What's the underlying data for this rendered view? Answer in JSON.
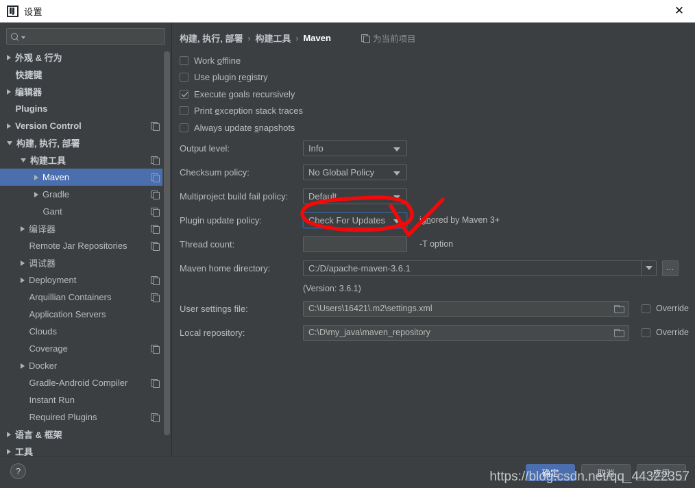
{
  "window": {
    "title": "设置",
    "logo_icon": "intellij-idea-logo",
    "close_icon": "close-icon"
  },
  "sidebar": {
    "search": {
      "placeholder": "",
      "value": "",
      "icon": "search-icon",
      "caret_icon": "chevron-down-icon"
    },
    "items": [
      {
        "label": "外观 & 行为",
        "indent": 0,
        "twisty": "collapsed",
        "bold": true,
        "module": false,
        "selected": false
      },
      {
        "label": "快捷键",
        "indent": 0,
        "twisty": "none",
        "bold": true,
        "module": false,
        "selected": false
      },
      {
        "label": "编辑器",
        "indent": 0,
        "twisty": "collapsed",
        "bold": true,
        "module": false,
        "selected": false
      },
      {
        "label": "Plugins",
        "indent": 0,
        "twisty": "none",
        "bold": true,
        "module": false,
        "selected": false
      },
      {
        "label": "Version Control",
        "indent": 0,
        "twisty": "collapsed",
        "bold": true,
        "module": true,
        "selected": false
      },
      {
        "label": "构建, 执行, 部署",
        "indent": 0,
        "twisty": "expanded",
        "bold": true,
        "module": false,
        "selected": false
      },
      {
        "label": "构建工具",
        "indent": 1,
        "twisty": "expanded",
        "bold": true,
        "module": true,
        "selected": false
      },
      {
        "label": "Maven",
        "indent": 2,
        "twisty": "collapsed",
        "bold": false,
        "module": true,
        "selected": true
      },
      {
        "label": "Gradle",
        "indent": 2,
        "twisty": "collapsed",
        "bold": false,
        "module": true,
        "selected": false
      },
      {
        "label": "Gant",
        "indent": 2,
        "twisty": "none",
        "bold": false,
        "module": true,
        "selected": false
      },
      {
        "label": "编译器",
        "indent": 1,
        "twisty": "collapsed",
        "bold": false,
        "module": true,
        "selected": false
      },
      {
        "label": "Remote Jar Repositories",
        "indent": 1,
        "twisty": "none",
        "bold": false,
        "module": true,
        "selected": false
      },
      {
        "label": "调试器",
        "indent": 1,
        "twisty": "collapsed",
        "bold": false,
        "module": false,
        "selected": false
      },
      {
        "label": "Deployment",
        "indent": 1,
        "twisty": "collapsed",
        "bold": false,
        "module": true,
        "selected": false
      },
      {
        "label": "Arquillian Containers",
        "indent": 1,
        "twisty": "none",
        "bold": false,
        "module": true,
        "selected": false
      },
      {
        "label": "Application Servers",
        "indent": 1,
        "twisty": "none",
        "bold": false,
        "module": false,
        "selected": false
      },
      {
        "label": "Clouds",
        "indent": 1,
        "twisty": "none",
        "bold": false,
        "module": false,
        "selected": false
      },
      {
        "label": "Coverage",
        "indent": 1,
        "twisty": "none",
        "bold": false,
        "module": true,
        "selected": false
      },
      {
        "label": "Docker",
        "indent": 1,
        "twisty": "collapsed",
        "bold": false,
        "module": false,
        "selected": false
      },
      {
        "label": "Gradle-Android Compiler",
        "indent": 1,
        "twisty": "none",
        "bold": false,
        "module": true,
        "selected": false
      },
      {
        "label": "Instant Run",
        "indent": 1,
        "twisty": "none",
        "bold": false,
        "module": false,
        "selected": false
      },
      {
        "label": "Required Plugins",
        "indent": 1,
        "twisty": "none",
        "bold": false,
        "module": true,
        "selected": false
      },
      {
        "label": "语言 & 框架",
        "indent": 0,
        "twisty": "collapsed",
        "bold": true,
        "module": false,
        "selected": false
      },
      {
        "label": "工具",
        "indent": 0,
        "twisty": "collapsed",
        "bold": true,
        "module": false,
        "selected": false
      }
    ]
  },
  "content": {
    "breadcrumb": {
      "parts": [
        "构建, 执行, 部署",
        "构建工具",
        "Maven"
      ],
      "separator": "›"
    },
    "project_badge": {
      "label": "为当前项目",
      "icon": "module-icon"
    },
    "checkboxes": [
      {
        "label_before": "Work ",
        "mnemonic": "o",
        "label_after": "ffline",
        "checked": false
      },
      {
        "label_before": "Use plugin ",
        "mnemonic": "r",
        "label_after": "egistry",
        "checked": false
      },
      {
        "label_before": "Execute ",
        "mnemonic": "g",
        "label_after": "oals recursively",
        "checked": true
      },
      {
        "label_before": "Print ",
        "mnemonic": "e",
        "label_after": "xception stack traces",
        "checked": false
      },
      {
        "label_before": "Always update ",
        "mnemonic": "s",
        "label_after": "napshots",
        "checked": false
      }
    ],
    "combos": [
      {
        "label": "Output level:",
        "value": "Info",
        "focused": false,
        "hint": ""
      },
      {
        "label": "Checksum policy:",
        "value": "No Global Policy",
        "focused": false,
        "hint": ""
      },
      {
        "label": "Multiproject build fail policy:",
        "value": "Default",
        "focused": false,
        "hint": ""
      },
      {
        "label": "Plugin update policy:",
        "value": "Check For Updates",
        "focused": true,
        "hint_before": "ign",
        "hint_mnemonic": "",
        "hint_after": "ored by Maven 3+"
      }
    ],
    "thread_count": {
      "label": "Thread count:",
      "value": "",
      "hint": "-T option"
    },
    "maven_home": {
      "label": "Maven home directory:",
      "value": "C:/D/apache-maven-3.6.1",
      "dropdown_icon": "chevron-down-icon",
      "browse_label": "...",
      "version_text": "(Version: 3.6.1)"
    },
    "paths": [
      {
        "label": "User settings file:",
        "value": "C:\\Users\\16421\\.m2\\settings.xml",
        "folder_icon": "folder-icon",
        "override_label": "Override",
        "override_checked": false
      },
      {
        "label": "Local repository:",
        "value": "C:\\D\\my_java\\maven_repository",
        "folder_icon": "folder-icon",
        "override_label": "Override",
        "override_checked": false
      }
    ]
  },
  "bottom": {
    "help_label": "?",
    "buttons": [
      {
        "label": "确定",
        "primary": true
      },
      {
        "label": "取消",
        "primary": false
      },
      {
        "label": "应用",
        "primary": false
      }
    ],
    "watermark": "https://blog.csdn.net/qq_44322357"
  },
  "annotation": {
    "color": "#f00a0a",
    "shapes": [
      "ellipse-around-plugin-update-policy",
      "arrow-pointing-to-dropdown"
    ]
  }
}
